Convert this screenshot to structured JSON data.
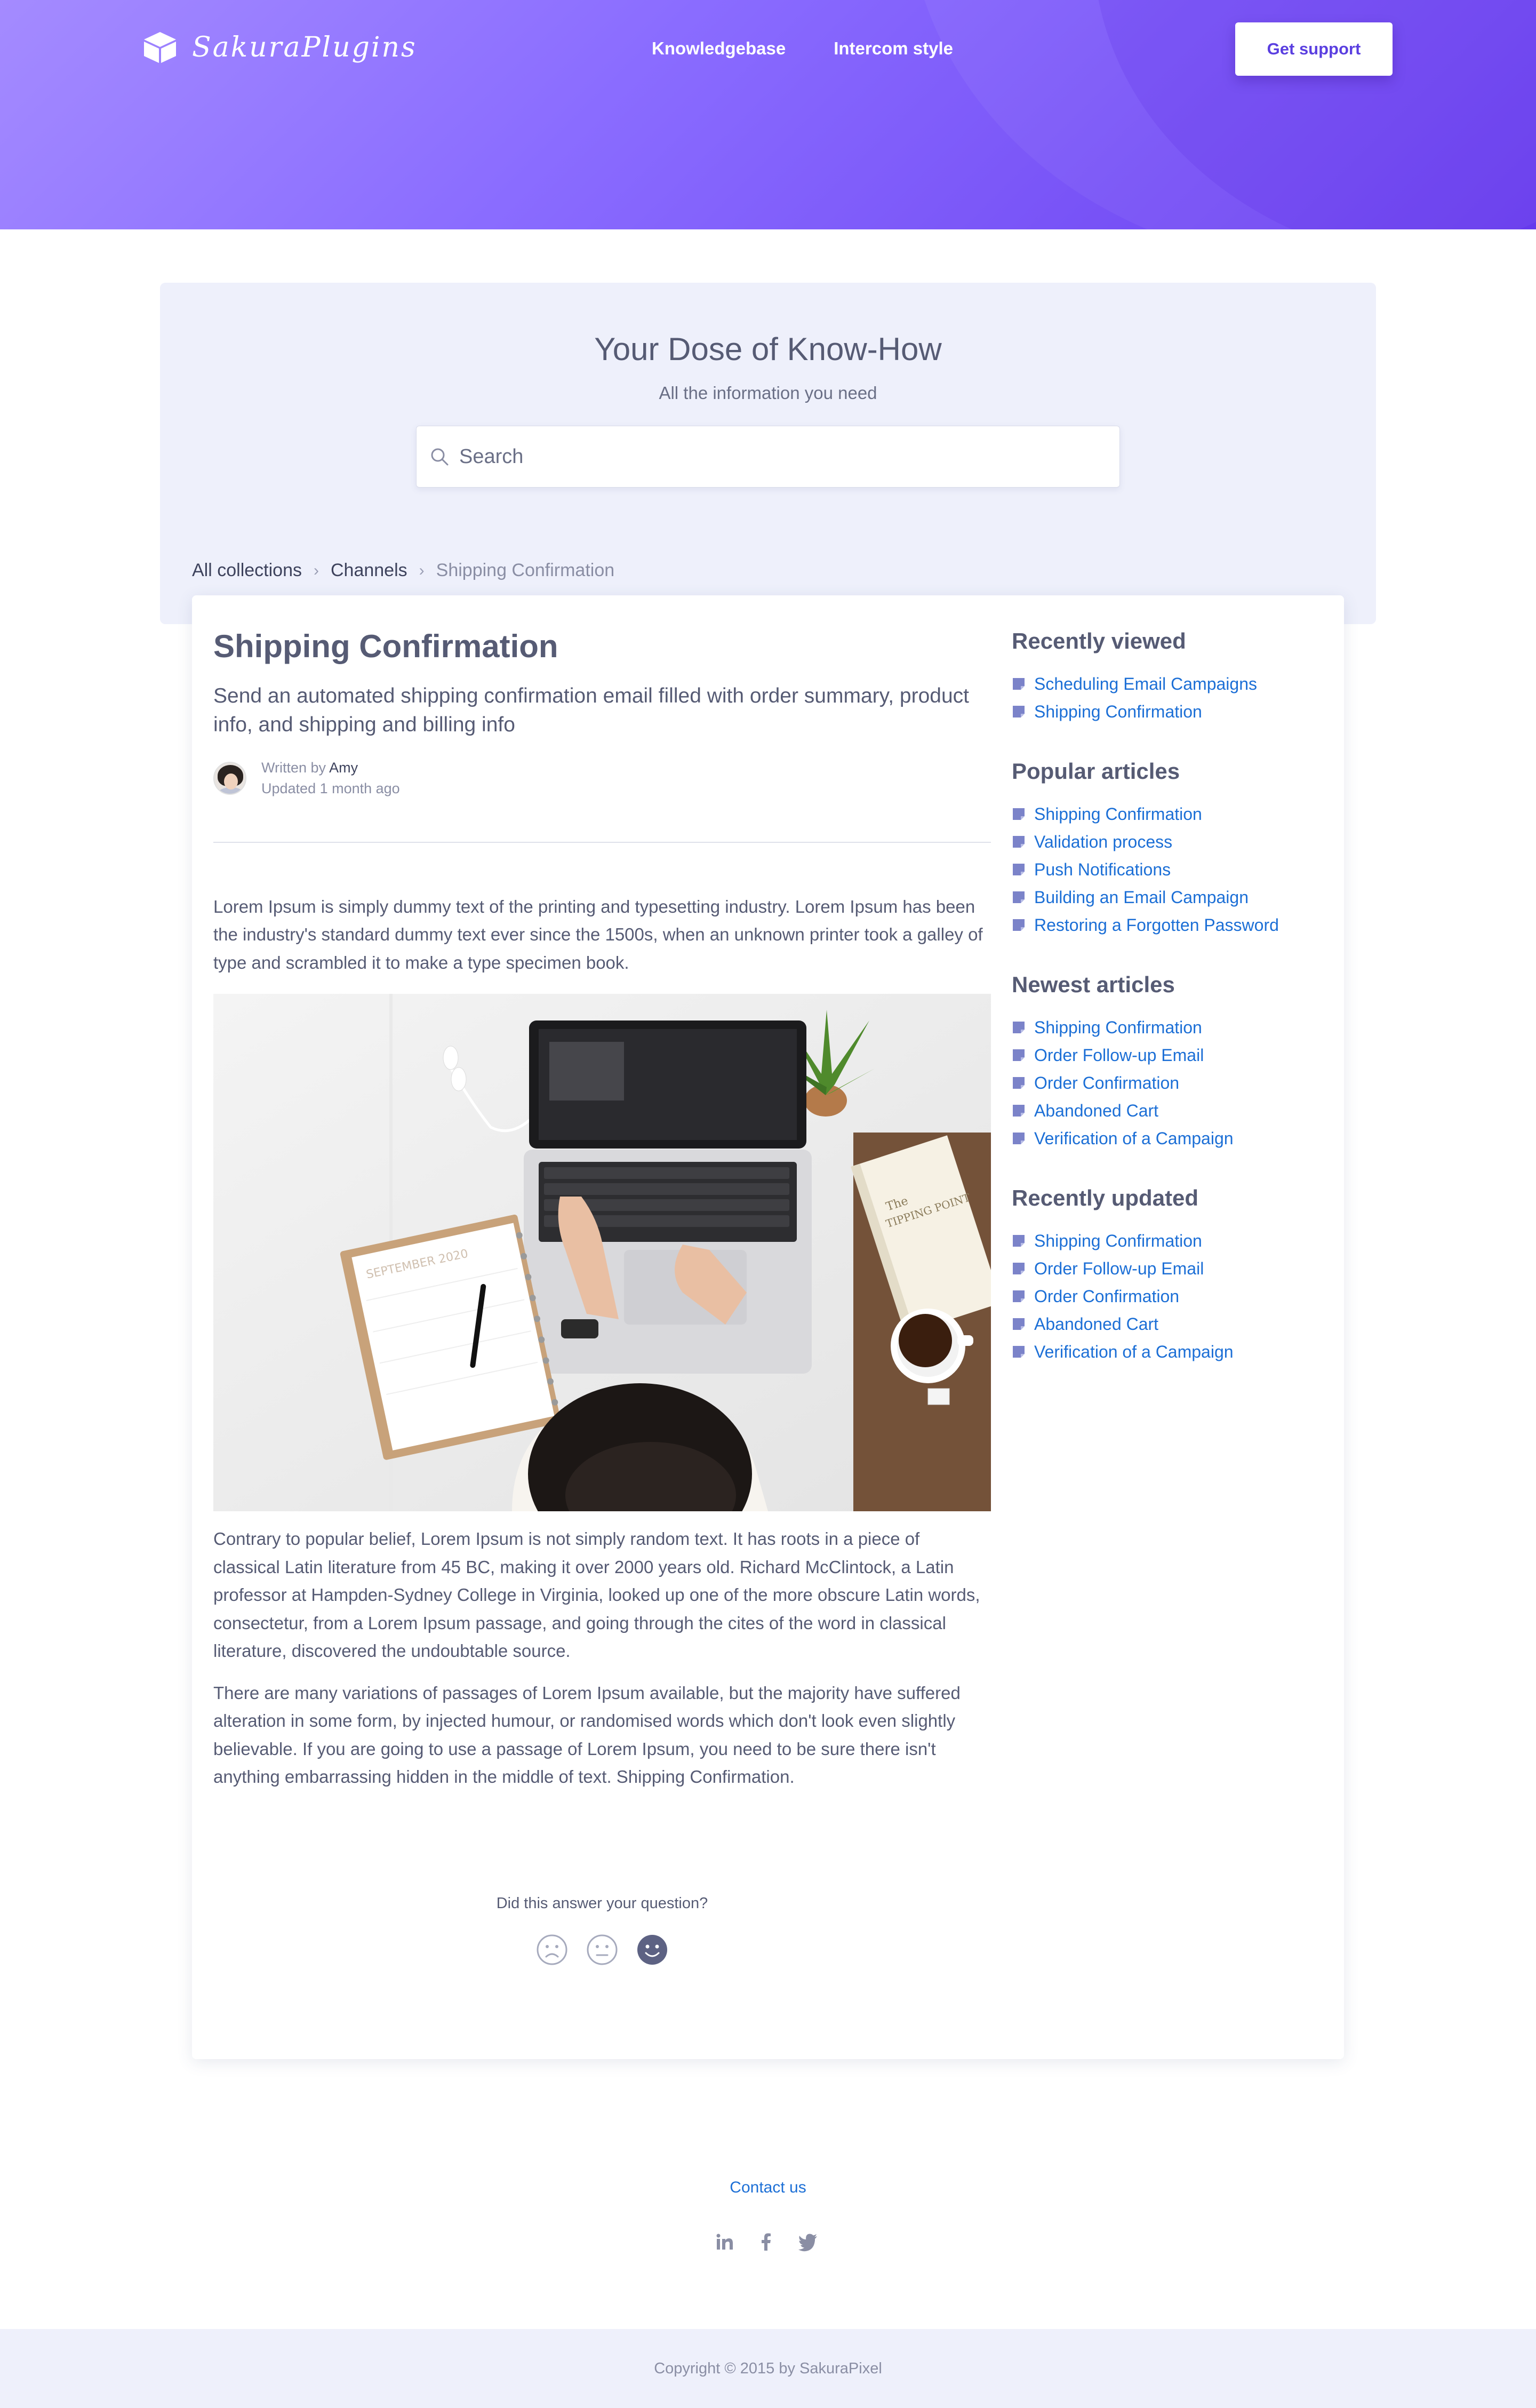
{
  "header": {
    "brand": "SakuraPlugins",
    "nav": [
      "Knowledgebase",
      "Intercom style"
    ],
    "support_button": "Get support"
  },
  "hero": {
    "title": "Your Dose of Know-How",
    "subtitle": "All the information you need",
    "search_placeholder": "Search"
  },
  "breadcrumb": {
    "items": [
      "All collections",
      "Channels"
    ],
    "current": "Shipping Confirmation"
  },
  "article": {
    "title": "Shipping Confirmation",
    "description": "Send an automated shipping confirmation email filled with order summary, product info, and shipping and billing info",
    "written_by_label": "Written by",
    "author": "Amy",
    "updated": "Updated 1 month ago",
    "paragraphs": [
      "Lorem Ipsum is simply dummy text of the printing and typesetting industry. Lorem Ipsum has been the industry's standard dummy text ever since the 1500s, when an unknown printer took a galley of type and scrambled it to make a type specimen book.",
      "Contrary to popular belief, Lorem Ipsum is not simply random text. It has roots in a piece of classical Latin literature from 45 BC, making it over 2000 years old. Richard McClintock, a Latin professor at Hampden-Sydney College in Virginia, looked up one of the more obscure Latin words, consectetur, from a Lorem Ipsum passage, and going through the cites of the word in classical literature, discovered the undoubtable source.",
      "There are many variations of passages of Lorem Ipsum available, but the majority have suffered alteration in some form, by injected humour, or randomised words which don't look even slightly believable. If you are going to use a passage of Lorem Ipsum, you need to be sure there isn't anything embarrassing hidden in the middle of text. Shipping Confirmation."
    ],
    "feedback_question": "Did this answer your question?"
  },
  "sidebar": {
    "sections": [
      {
        "title": "Recently viewed",
        "items": [
          "Scheduling Email Campaigns",
          "Shipping Confirmation"
        ]
      },
      {
        "title": "Popular articles",
        "items": [
          "Shipping Confirmation",
          "Validation process",
          "Push Notifications",
          "Building an Email Campaign",
          "Restoring a Forgotten Password"
        ]
      },
      {
        "title": "Newest articles",
        "items": [
          "Shipping Confirmation",
          "Order Follow-up Email",
          "Order Confirmation",
          "Abandoned Cart",
          "Verification of a Campaign"
        ]
      },
      {
        "title": "Recently updated",
        "items": [
          "Shipping Confirmation",
          "Order Follow-up Email",
          "Order Confirmation",
          "Abandoned Cart",
          "Verification of a Campaign"
        ]
      }
    ]
  },
  "footer": {
    "contact": "Contact us",
    "social": [
      "linkedin-icon",
      "facebook-icon",
      "twitter-icon"
    ],
    "copyright": "Copyright © 2015 by SakuraPixel"
  },
  "colors": {
    "header_gradient_start": "#a48bff",
    "header_gradient_end": "#6a3ff0",
    "link": "#1c6fd6",
    "panel_bg": "#eef0fb",
    "doc_icon": "#7b83c9"
  }
}
